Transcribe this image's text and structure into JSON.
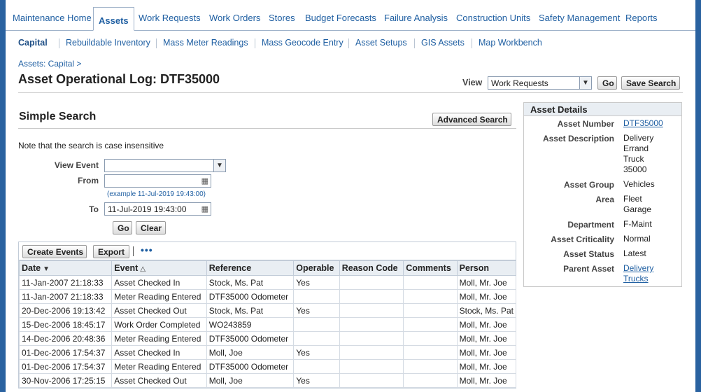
{
  "top_tabs": [
    "Maintenance Home",
    "Assets",
    "Work Requests",
    "Work Orders",
    "Stores",
    "Budget Forecasts",
    "Failure Analysis",
    "Construction Units",
    "Safety Management",
    "Reports"
  ],
  "sub_tabs": [
    "Capital",
    "Rebuildable Inventory",
    "Mass Meter Readings",
    "Mass Geocode Entry",
    "Asset Setups",
    "GIS Assets",
    "Map Workbench"
  ],
  "breadcrumb": "Assets: Capital  >",
  "page_title": "Asset Operational Log: DTF35000",
  "view": {
    "label": "View",
    "selected": "Work Requests",
    "go": "Go",
    "save_search": "Save Search"
  },
  "search": {
    "title": "Simple Search",
    "advanced": "Advanced Search",
    "note": "Note that the search is case insensitive",
    "view_event_label": "View Event",
    "view_event_value": "",
    "from_label": "From",
    "from_value": "",
    "from_hint": "(example 11-Jul-2019 19:43:00)",
    "to_label": "To",
    "to_value": "11-Jul-2019 19:43:00",
    "go": "Go",
    "clear": "Clear"
  },
  "results": {
    "create_events": "Create Events",
    "export": "Export",
    "more": "•••",
    "columns": [
      "Date",
      "Event",
      "Reference",
      "Operable",
      "Reason Code",
      "Comments",
      "Person"
    ],
    "rows": [
      [
        "11-Jan-2007 21:18:33",
        "Asset Checked In",
        "Stock, Ms. Pat",
        "Yes",
        "",
        "",
        "Moll, Mr. Joe"
      ],
      [
        "11-Jan-2007 21:18:33",
        "Meter Reading Entered",
        "DTF35000 Odometer",
        "",
        "",
        "",
        "Moll, Mr. Joe"
      ],
      [
        "20-Dec-2006 19:13:42",
        "Asset Checked Out",
        "Stock, Ms. Pat",
        "Yes",
        "",
        "",
        "Stock, Ms. Pat"
      ],
      [
        "15-Dec-2006 18:45:17",
        "Work Order Completed",
        "WO243859",
        "",
        "",
        "",
        "Moll, Mr. Joe"
      ],
      [
        "14-Dec-2006 20:48:36",
        "Meter Reading Entered",
        "DTF35000 Odometer",
        "",
        "",
        "",
        "Moll, Mr. Joe"
      ],
      [
        "01-Dec-2006 17:54:37",
        "Asset Checked In",
        "Moll, Joe",
        "Yes",
        "",
        "",
        "Moll, Mr. Joe"
      ],
      [
        "01-Dec-2006 17:54:37",
        "Meter Reading Entered",
        "DTF35000 Odometer",
        "",
        "",
        "",
        "Moll, Mr. Joe"
      ],
      [
        "30-Nov-2006 17:25:15",
        "Asset Checked Out",
        "Moll, Joe",
        "Yes",
        "",
        "",
        "Moll, Mr. Joe"
      ]
    ]
  },
  "asset_details": {
    "title": "Asset Details",
    "asset_number_label": "Asset Number",
    "asset_number": "DTF35000",
    "asset_description_label": "Asset Description",
    "asset_description": "Delivery Errand Truck 35000",
    "asset_group_label": "Asset Group",
    "asset_group": "Vehicles",
    "area_label": "Area",
    "area": "Fleet Garage",
    "department_label": "Department",
    "department": "F-Maint",
    "asset_criticality_label": "Asset Criticality",
    "asset_criticality": "Normal",
    "asset_status_label": "Asset Status",
    "asset_status": "Latest",
    "parent_asset_label": "Parent Asset",
    "parent_asset": "Delivery Trucks"
  }
}
